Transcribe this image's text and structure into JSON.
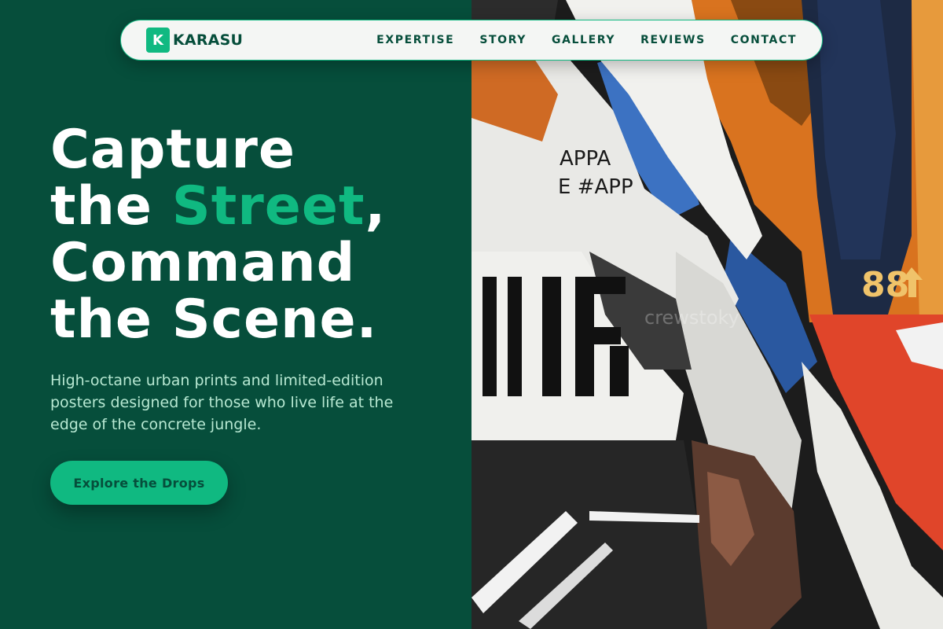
{
  "brand": {
    "mark": "K",
    "name": "KARASU"
  },
  "nav": {
    "items": [
      {
        "label": "EXPERTISE"
      },
      {
        "label": "STORY"
      },
      {
        "label": "GALLERY"
      },
      {
        "label": "REVIEWS"
      },
      {
        "label": "CONTACT"
      }
    ]
  },
  "hero": {
    "line1": "Capture",
    "line2_pre": "the ",
    "line2_accent": "Street",
    "line2_post": ",",
    "line3": "Command",
    "line4": "the Scene.",
    "subtitle": "High-octane urban prints and limited-edition posters designed for those who live life at the edge of the concrete jungle.",
    "cta_label": "Explore the Drops"
  },
  "poster": {
    "text_top": "APPA",
    "text_mid": "E #APP",
    "big_letters": "IIRF",
    "number": "88",
    "watermark": "crewstoky"
  },
  "colors": {
    "primary_dark": "#064e3b",
    "accent": "#10b981",
    "nav_bg": "#f4f6f4",
    "subtitle": "#b7e8d2"
  }
}
